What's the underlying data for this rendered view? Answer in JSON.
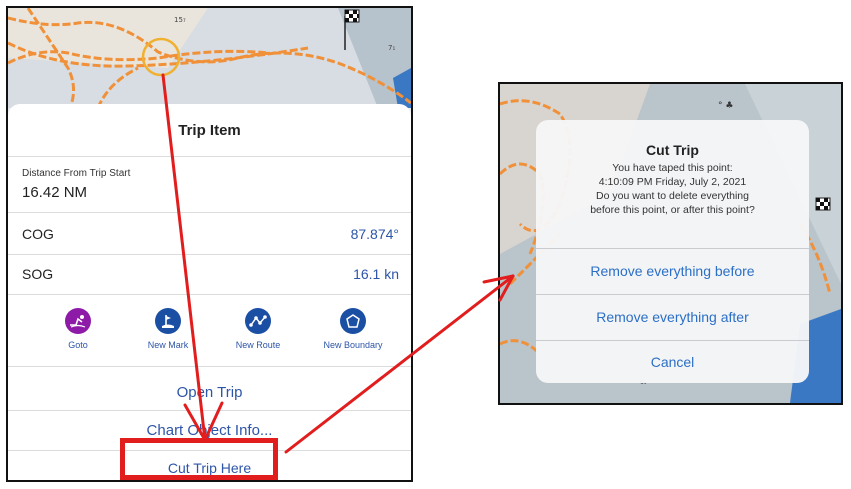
{
  "trip_item": {
    "title": "Trip Item",
    "distance_label": "Distance From Trip Start",
    "distance_value": "16.42 NM",
    "cog_label": "COG",
    "cog_value": "87.874°",
    "sog_label": "SOG",
    "sog_value": "16.1 kn",
    "actions": [
      {
        "label": "Goto",
        "icon": "goto-icon",
        "color": "#8e1aa8"
      },
      {
        "label": "New Mark",
        "icon": "mark-icon",
        "color": "#1b4fa3"
      },
      {
        "label": "New Route",
        "icon": "route-icon",
        "color": "#1b4fa3"
      },
      {
        "label": "New Boundary",
        "icon": "boundary-icon",
        "color": "#1b4fa3"
      }
    ],
    "open_trip": "Open Trip",
    "chart_object_info": "Chart Object Info...",
    "cut_trip_here": "Cut Trip Here"
  },
  "cut_trip_dialog": {
    "title": "Cut Trip",
    "message_lines": [
      "You have taped this point:",
      "4:10:09 PM Friday, July 2, 2021",
      "Do you want to delete everything",
      "before this point, or after this point?"
    ],
    "remove_before": "Remove everything before",
    "remove_after": "Remove everything after",
    "cancel": "Cancel"
  },
  "colors": {
    "accent_blue": "#2d55a8",
    "annotation_red": "#e21d1d",
    "track_orange": "#f0913a"
  }
}
